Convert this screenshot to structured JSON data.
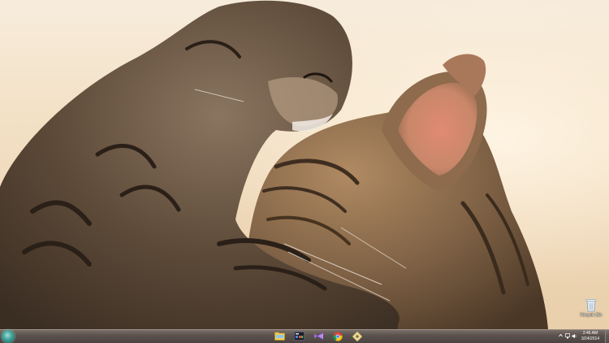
{
  "desktop": {
    "wallpaper": "photo-two-tabby-cats",
    "icons": [
      {
        "icon": "recycle-bin-icon",
        "label": "Recycle Bin"
      }
    ]
  },
  "taskbar": {
    "start_icon": "windows-orb-icon",
    "pinned": [
      {
        "icon": "file-explorer-icon"
      },
      {
        "icon": "start-menu-app-icon"
      },
      {
        "icon": "visual-studio-icon"
      },
      {
        "icon": "chrome-icon"
      },
      {
        "icon": "pinned-app-icon"
      }
    ],
    "tray": [
      {
        "icon": "show-hidden-icons-chevron-icon"
      },
      {
        "icon": "network-icon"
      },
      {
        "icon": "volume-icon"
      }
    ],
    "clock": {
      "time": "2:46 AM",
      "date": "3/24/2014"
    }
  }
}
